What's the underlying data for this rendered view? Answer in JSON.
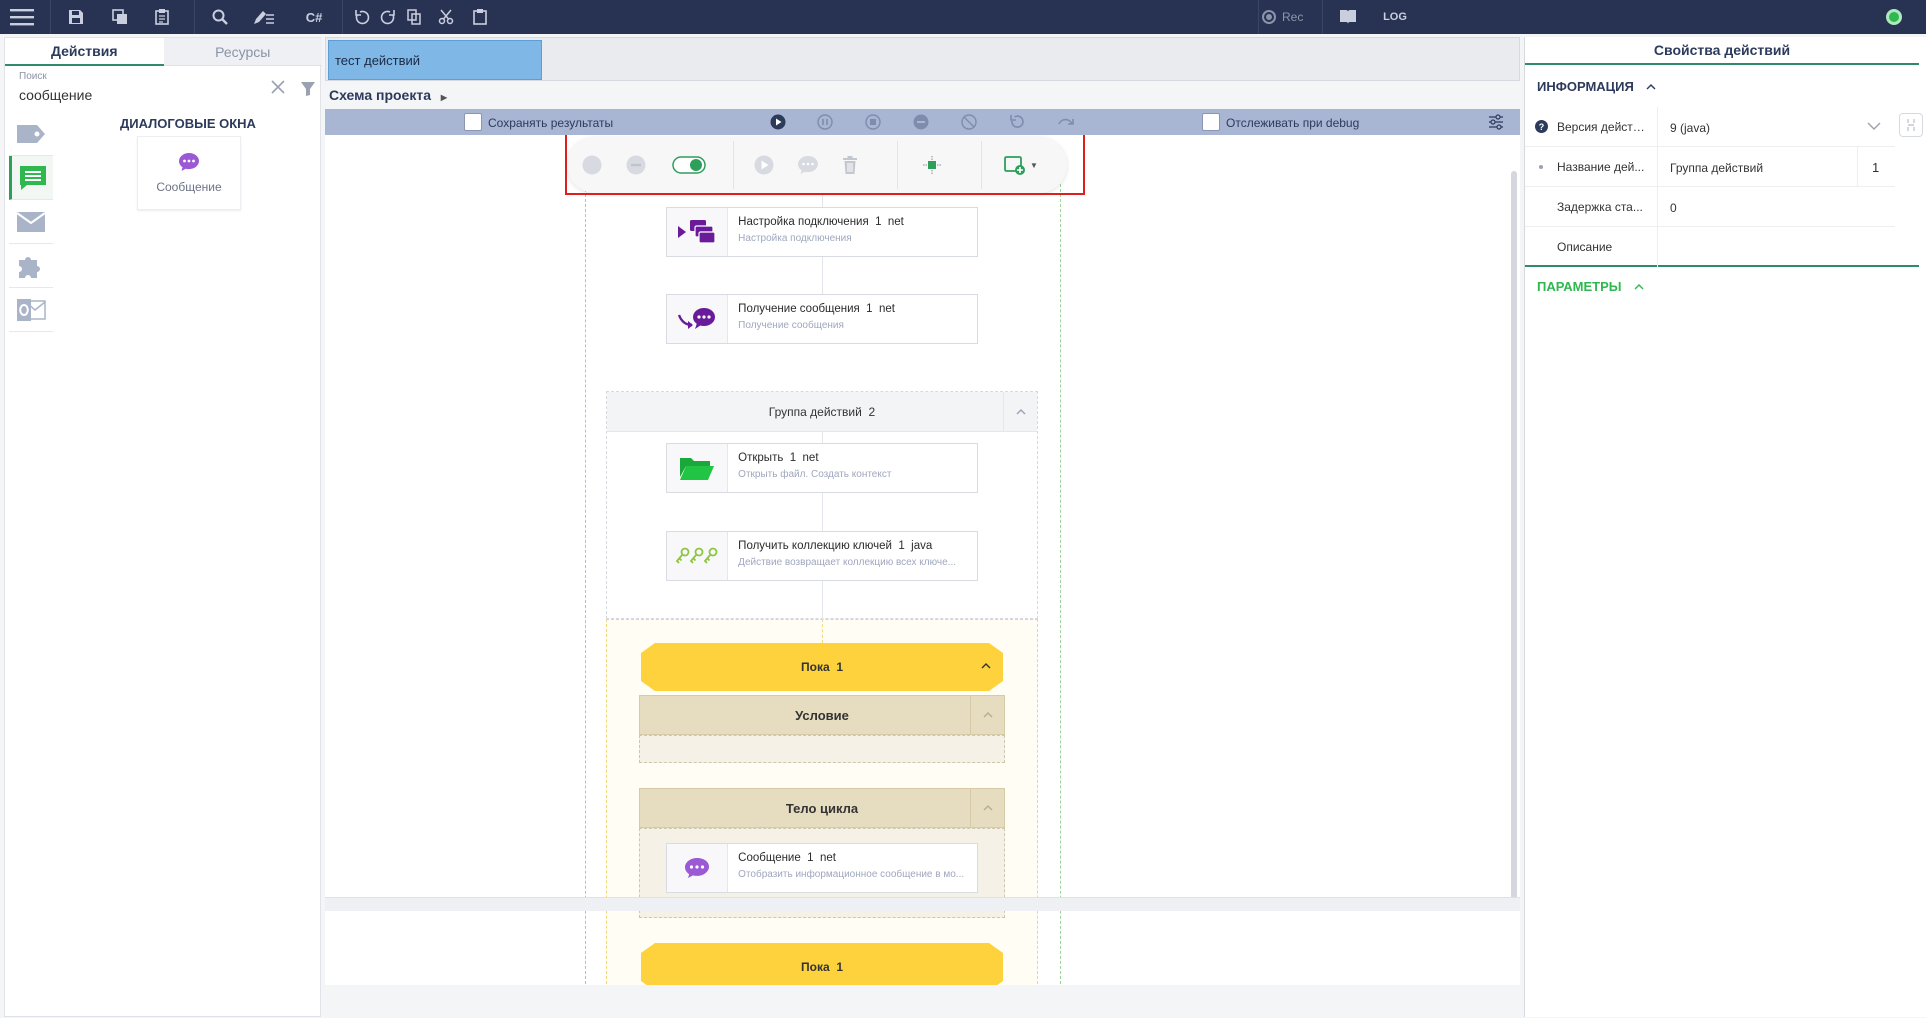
{
  "colors": {
    "topbar": "#283353",
    "accent": "#2e8b6b",
    "node_purple": "#6a1b9a",
    "yellow": "#fdd23c",
    "highlight_box": "#e01e1e"
  },
  "topbar": {
    "rec_label": "Rec",
    "log_label": "LOG",
    "csharp_label": "C#"
  },
  "left_panel": {
    "tabs": [
      {
        "label": "Действия"
      },
      {
        "label": "Ресурсы"
      }
    ],
    "search": {
      "label": "Поиск",
      "value": "сообщение"
    },
    "category_heading": "ДИАЛОГОВЫЕ ОКНА",
    "items": [
      {
        "label": "Сообщение",
        "icon": "chat-bubble-icon"
      }
    ],
    "categories": [
      "tag-icon",
      "message-list-icon",
      "envelope-icon",
      "puzzle-icon",
      "outlook-icon"
    ]
  },
  "editor": {
    "doc_tab": "тест действий",
    "breadcrumb": "Схема проекта",
    "save_results_label": "Сохранять результаты",
    "track_debug_label": "Отслеживать при debug",
    "nodes": [
      {
        "title": "Настройка подключения",
        "count": "1",
        "platform": "net",
        "subtitle": "Настройка подключения",
        "icon": "connection-settings-icon"
      },
      {
        "title": "Получение сообщения",
        "count": "1",
        "platform": "net",
        "subtitle": "Получение сообщения",
        "icon": "receive-message-icon"
      },
      {
        "title": "Открыть",
        "count": "1",
        "platform": "net",
        "subtitle": "Открыть файл. Создать контекст",
        "icon": "folder-open-icon"
      },
      {
        "title": "Получить коллекцию ключей",
        "count": "1",
        "platform": "java",
        "subtitle": "Действие возвращает коллекцию всех ключе...",
        "icon": "keys-icon"
      },
      {
        "title": "Сообщение",
        "count": "1",
        "platform": "net",
        "subtitle": "Отобразить информационное сообщение в мо...",
        "icon": "message-icon"
      }
    ],
    "group": {
      "title": "Группа действий",
      "count": "2"
    },
    "loop": {
      "title": "Пока",
      "count": "1",
      "condition_label": "Условие",
      "body_label": "Тело цикла"
    }
  },
  "right_panel": {
    "title": "Свойства действий",
    "info_section": "ИНФОРМАЦИЯ",
    "params_section": "ПАРАМЕТРЫ",
    "properties": [
      {
        "label": "Версия действ...",
        "value": "9 (java)"
      },
      {
        "label": "Название дей...",
        "value": "Группа действий",
        "extra": "1"
      },
      {
        "label": "Задержка ста...",
        "value": "0"
      },
      {
        "label": "Описание",
        "value": ""
      }
    ]
  }
}
